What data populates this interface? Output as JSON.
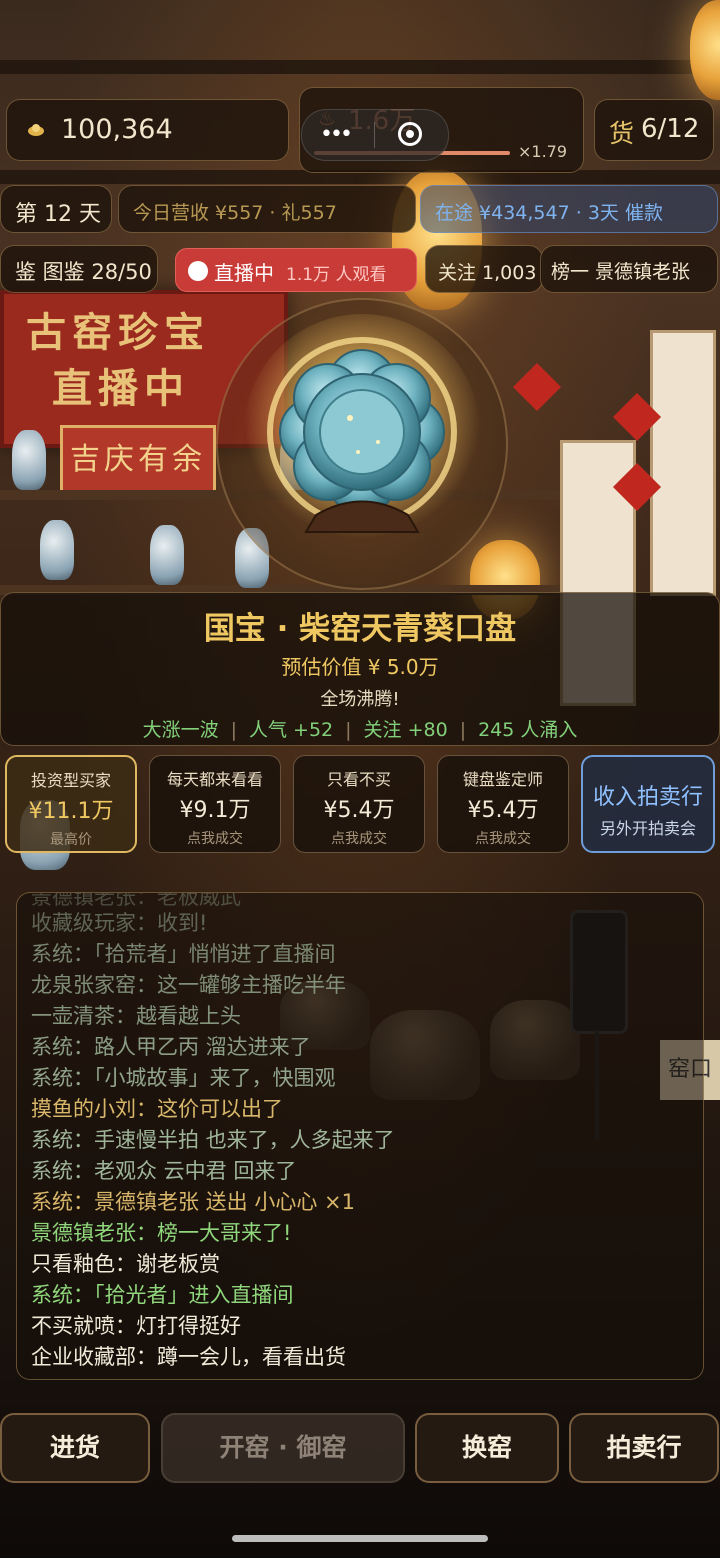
{
  "top": {
    "coins": "100,364",
    "heat": "1.6万",
    "heat_multiplier": "×1.79",
    "heat_level": 0.96,
    "cargo_label": "货",
    "cargo": "6/12"
  },
  "status": {
    "day": "第 12 天",
    "revenue": "今日营收 ¥557 · 礼557",
    "transit": "在途 ¥434,547 · 3天 催款"
  },
  "bar": {
    "catalog": "鉴 图鉴 28/50",
    "live_label": "直播中",
    "live_viewers": "1.1万 人观看",
    "follow": "关注 1,003",
    "rank": "榜一 景德镇老张"
  },
  "artifact": {
    "title": "国宝 · 柴窑天青葵口盘",
    "value": "预估价值 ¥ 5.0万",
    "mood": "全场沸腾!",
    "stats": [
      "大涨一波",
      "人气 +52",
      "关注 +80",
      "245 人涌入"
    ]
  },
  "offers": [
    {
      "name": "投资型买家",
      "price": "¥11.1万",
      "note": "最高价"
    },
    {
      "name": "每天都来看看",
      "price": "¥9.1万",
      "note": "点我成交"
    },
    {
      "name": "只看不买",
      "price": "¥5.4万",
      "note": "点我成交"
    },
    {
      "name": "键盘鉴定师",
      "price": "¥5.4万",
      "note": "点我成交"
    }
  ],
  "auction": {
    "title": "收入拍卖行",
    "sub": "另外开拍卖会"
  },
  "chat": [
    {
      "text": "景德镇老张：老板威武",
      "style": "c-sys"
    },
    {
      "text": "收藏级玩家：收到!",
      "style": "c-sys"
    },
    {
      "text": "系统：「拾荒者」悄悄进了直播间",
      "style": "c-sys"
    },
    {
      "text": "龙泉张家窑：这一罐够主播吃半年",
      "style": "c-sys"
    },
    {
      "text": "一壶清茶：越看越上头",
      "style": "c-sys"
    },
    {
      "text": "系统：路人甲乙丙 溜达进来了",
      "style": "c-sys"
    },
    {
      "text": "系统：「小城故事」来了，快围观",
      "style": "c-sys"
    },
    {
      "text": "摸鱼的小刘：这价可以出了",
      "style": "c-gold"
    },
    {
      "text": "系统：手速慢半拍 也来了，人多起来了",
      "style": "c-sys"
    },
    {
      "text": "系统：老观众 云中君 回来了",
      "style": "c-sys"
    },
    {
      "text": "系统：景德镇老张 送出 小心心 ×1",
      "style": "c-gold"
    },
    {
      "text": "景德镇老张：榜一大哥来了!",
      "style": "c-green"
    },
    {
      "text": "只看釉色：谢老板赏",
      "style": "c-white"
    },
    {
      "text": "系统：「拾光者」进入直播间",
      "style": "c-green"
    },
    {
      "text": "不买就喷：灯打得挺好",
      "style": "c-white"
    },
    {
      "text": "企业收藏部：蹲一会儿，看看出货",
      "style": "c-white"
    }
  ],
  "bottom": {
    "restock": "进货",
    "kiln": "开窑 · 御窑",
    "switch": "换窑",
    "auction": "拍卖行"
  },
  "scene": {
    "banner_lines": [
      "古窑珍宝",
      "直播中"
    ],
    "tag": "吉庆有余",
    "stall": "窑口"
  },
  "colors": {
    "accent": "#e8c46a",
    "live": "#c93b36",
    "positive": "#7fd17a",
    "info": "#7fb3f0"
  },
  "icons": {
    "coins": "gold-ingot-icon",
    "heat": "flame-icon",
    "live": "live-dot-icon"
  }
}
